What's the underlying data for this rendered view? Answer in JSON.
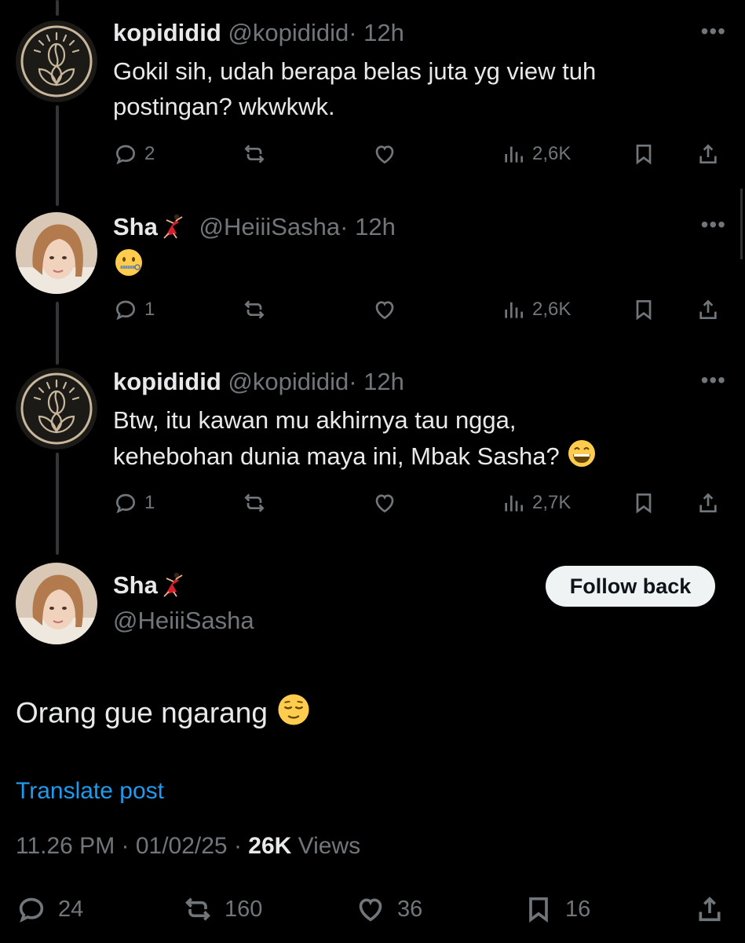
{
  "replies": [
    {
      "name": "kopididid",
      "handle": "@kopididid",
      "time": "· 12h",
      "avatar": "coffee-logo",
      "text_lines": [
        "Gokil sih, udah berapa belas juta yg view tuh",
        "postingan? wkwkwk."
      ],
      "emoji": "",
      "reply_count": "2",
      "views": "2,6K"
    },
    {
      "name": "Sha",
      "handle": "@HeiiiSasha",
      "time": "· 12h",
      "avatar": "profile-photo",
      "name_emoji": "dancer",
      "text_lines": [
        ""
      ],
      "emoji": "zipper-mouth-face",
      "reply_count": "1",
      "views": "2,6K"
    },
    {
      "name": "kopididid",
      "handle": "@kopididid",
      "time": "· 12h",
      "avatar": "coffee-logo",
      "text_lines": [
        "Btw, itu kawan mu akhirnya tau ngga,",
        "kehebohan dunia maya ini, Mbak Sasha?"
      ],
      "emoji": "grinning-face",
      "reply_count": "1",
      "views": "2,7K"
    }
  ],
  "main_post": {
    "name": "Sha",
    "handle": "@HeiiiSasha",
    "follow_label": "Follow back",
    "text": "Orang gue ngarang",
    "text_emoji": "relieved-face",
    "translate_label": "Translate post",
    "timestamp": "11.26 PM · 01/02/25 · ",
    "views_count": "26K",
    "views_label": " Views",
    "stats": {
      "replies": "24",
      "reposts": "160",
      "likes": "36",
      "bookmarks": "16"
    }
  },
  "colors": {
    "background": "#000000",
    "text": "#e7e9ea",
    "muted": "#71767b",
    "link": "#1d9bf0",
    "button_bg": "#eff3f4"
  },
  "icons": [
    "reply-icon",
    "repost-icon",
    "like-icon",
    "views-icon",
    "bookmark-icon",
    "share-icon",
    "more-icon"
  ]
}
